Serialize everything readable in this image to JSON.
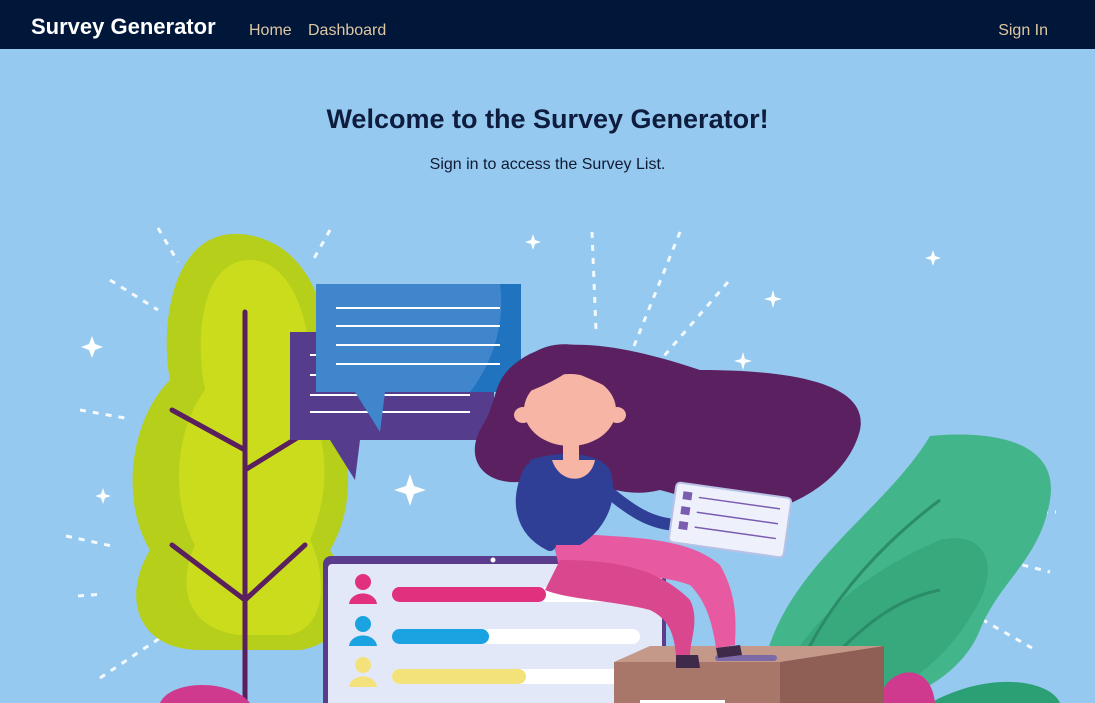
{
  "navbar": {
    "brand": "Survey Generator",
    "links": [
      {
        "label": "Home"
      },
      {
        "label": "Dashboard"
      }
    ],
    "sign_in": "Sign In"
  },
  "hero": {
    "title": "Welcome to the Survey Generator!",
    "subtitle": "Sign in to access the Survey List."
  },
  "illustration": {
    "survey_bars": [
      {
        "color": "#e0307e",
        "fill": 0.62
      },
      {
        "color": "#1aa3e0",
        "fill": 0.39
      },
      {
        "color": "#f3e27a",
        "fill": 0.54
      }
    ]
  },
  "colors": {
    "navbar_bg": "#00173a",
    "page_bg": "#95c9ef",
    "nav_link": "#e0c7a3",
    "brand_text": "#ffffff"
  }
}
